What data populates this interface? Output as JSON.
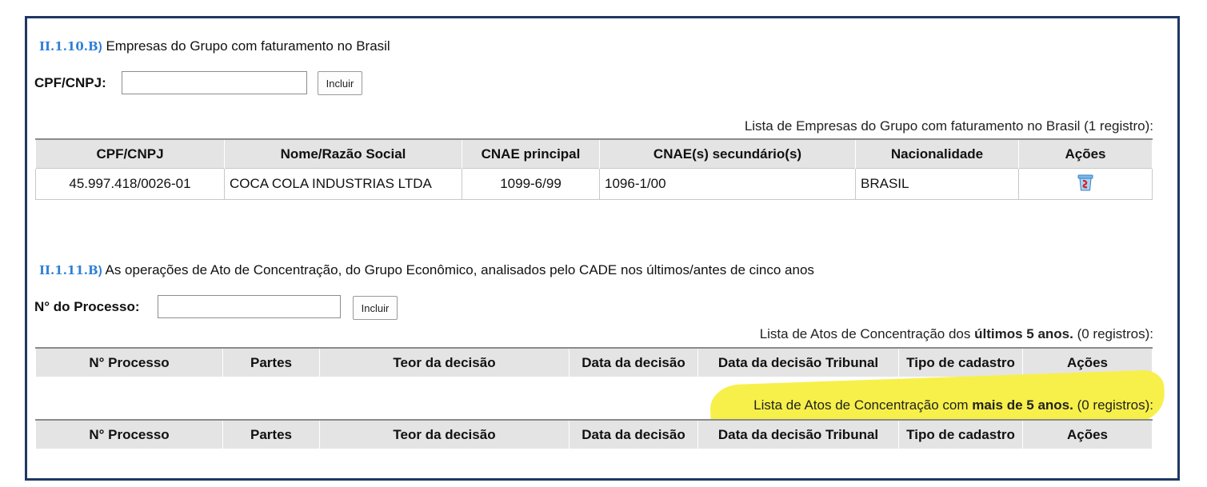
{
  "section1": {
    "code": "II.1.10.B",
    "paren": ")",
    "title": "Empresas do Grupo com faturamento no Brasil",
    "field_label": "CPF/CNPJ:",
    "field_value": "",
    "button": "Incluir",
    "caption": "Lista de Empresas do Grupo com faturamento no Brasil (1 registro):",
    "columns": [
      "CPF/CNPJ",
      "Nome/Razão Social",
      "CNAE principal",
      "CNAE(s) secundário(s)",
      "Nacionalidade",
      "Ações"
    ],
    "rows": [
      {
        "cpf_cnpj": "45.997.418/0026-01",
        "nome": "COCA COLA INDUSTRIAS LTDA",
        "cnae_principal": "1099-6/99",
        "cnae_secundarios": "1096-1/00",
        "nacionalidade": "BRASIL",
        "acao_icon": "delete-trash-icon"
      }
    ]
  },
  "section2": {
    "code": "II.1.11.B",
    "paren": ")",
    "title": "As operações de Ato de Concentração, do Grupo Econômico, analisados pelo CADE nos últimos/antes de cinco anos",
    "field_label": "N° do Processo:",
    "field_value": "",
    "button": "Incluir",
    "caption_recent": {
      "prefix": "Lista de Atos de Concentração dos ",
      "bold": "últimos 5 anos.",
      "suffix": " (0 registros):"
    },
    "caption_older": {
      "prefix": "Lista de Atos de Concentração com ",
      "bold": "mais de 5 anos.",
      "suffix": " (0 registros):"
    },
    "columns": [
      "N° Processo",
      "Partes",
      "Teor da decisão",
      "Data da decisão",
      "Data da decisão Tribunal",
      "Tipo de cadastro",
      "Ações"
    ],
    "highlight_color": "#f7f04a"
  },
  "colors": {
    "border": "#1f3864",
    "section_code": "#2f7fd6",
    "header_bg": "#e4e4e4"
  }
}
